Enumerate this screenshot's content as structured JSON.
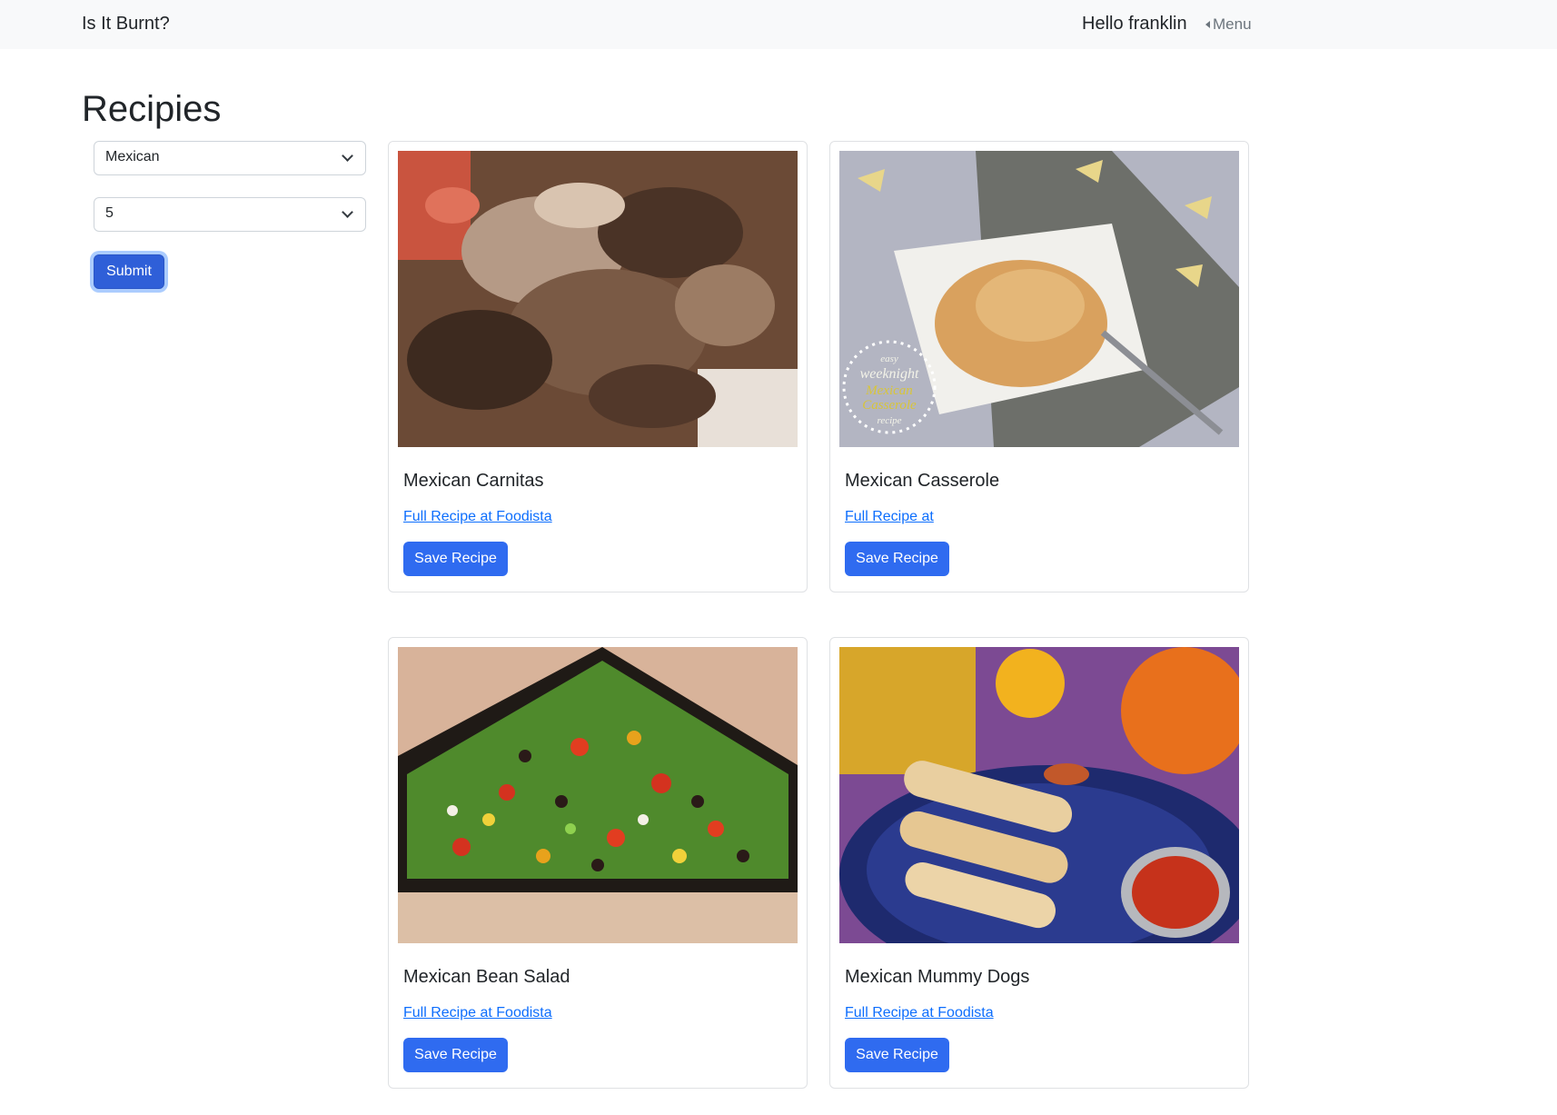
{
  "navbar": {
    "brand": "Is It Burnt?",
    "greeting": "Hello franklin",
    "menu_label": "Menu"
  },
  "page": {
    "title": "Recipies"
  },
  "filters": {
    "cuisine_selected": "Mexican",
    "count_selected": "5",
    "submit_label": "Submit"
  },
  "recipes": [
    {
      "title": "Mexican Carnitas",
      "link_text": "Full Recipe at Foodista",
      "save_label": "Save Recipe"
    },
    {
      "title": "Mexican Casserole",
      "link_text": "Full Recipe at",
      "save_label": "Save Recipe"
    },
    {
      "title": "Mexican Bean Salad",
      "link_text": "Full Recipe at Foodista",
      "save_label": "Save Recipe"
    },
    {
      "title": "Mexican Mummy Dogs",
      "link_text": "Full Recipe at Foodista",
      "save_label": "Save Recipe"
    }
  ],
  "photo_overlay": {
    "casserole_text": [
      "easy",
      "weeknight",
      "Mexican",
      "Casserole",
      "recipe"
    ]
  },
  "colors": {
    "primary": "#2f6bf0",
    "link": "#0d6efd",
    "navbar_bg": "#f8f9fa"
  }
}
